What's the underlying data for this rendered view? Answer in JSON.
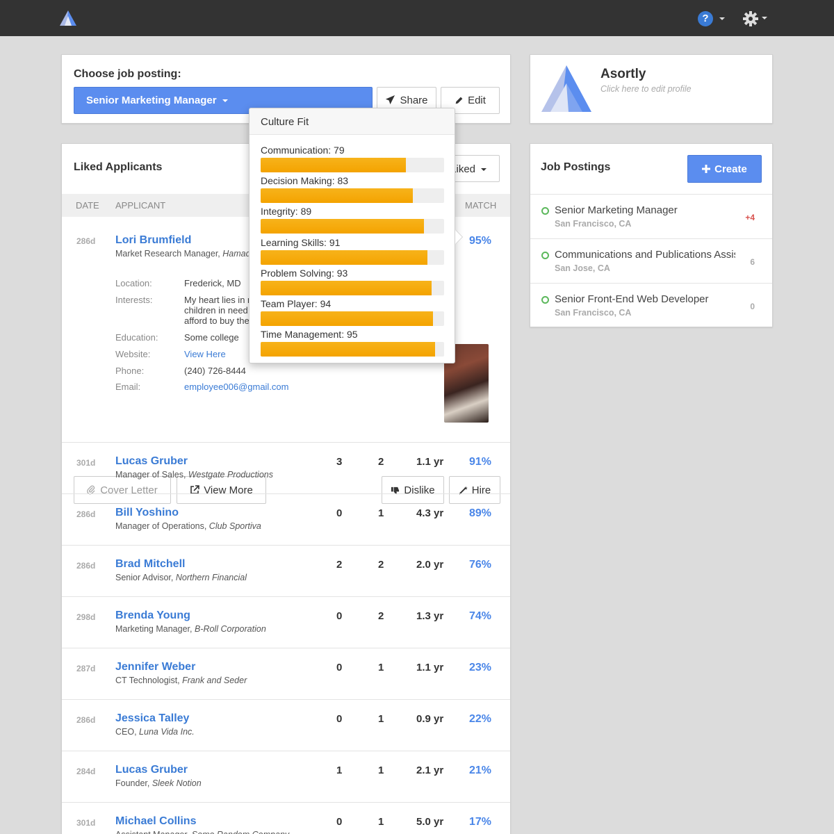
{
  "colors": {
    "accent": "#5b8def",
    "link": "#3a7bd5",
    "bar": "#f5a900",
    "online": "#5cb85c",
    "new": "#d9534f"
  },
  "nav": {
    "help_icon": "question-icon",
    "help_label": "?",
    "settings_icon": "gear-icon"
  },
  "choose": {
    "label": "Choose job posting:",
    "selected": "Senior Marketing Manager",
    "share_label": "Share",
    "edit_label": "Edit"
  },
  "profile": {
    "name": "Asortly",
    "hint": "Click here to edit profile"
  },
  "liked": {
    "title": "Liked Applicants",
    "filter_label": "Liked",
    "columns": {
      "date": "DATE",
      "applicant": "APPLICANT",
      "match": "MATCH"
    },
    "expanded": {
      "date": "286d",
      "name": "Lori Brumfield",
      "role": "Market Research Manager, ",
      "company": "Hamada",
      "match": "95%",
      "labels": {
        "location": "Location:",
        "interests": "Interests:",
        "education": "Education:",
        "website": "Website:",
        "phone": "Phone:",
        "email": "Email:"
      },
      "location": "Frederick, MD",
      "interests_1": "My heart lies in m",
      "interests_2": "children in need",
      "interests_3": "afford to buy the",
      "education": "Some college",
      "website": "View Here",
      "phone": "(240) 726-8444",
      "email": "employee006@gmail.com",
      "buttons": {
        "cover": "Cover Letter",
        "view_more": "View More",
        "dislike": "Dislike",
        "hire": "Hire"
      }
    },
    "rows": [
      {
        "date": "301d",
        "name": "Lucas Gruber",
        "role": "Manager of Sales, ",
        "company": "Westgate Productions",
        "c1": "3",
        "c2": "2",
        "exp": "1.1 yr",
        "match": "91%"
      },
      {
        "date": "286d",
        "name": "Bill Yoshino",
        "role": "Manager of Operations, ",
        "company": "Club Sportiva",
        "c1": "0",
        "c2": "1",
        "exp": "4.3 yr",
        "match": "89%"
      },
      {
        "date": "286d",
        "name": "Brad Mitchell",
        "role": "Senior Advisor, ",
        "company": "Northern Financial",
        "c1": "2",
        "c2": "2",
        "exp": "2.0 yr",
        "match": "76%"
      },
      {
        "date": "298d",
        "name": "Brenda Young",
        "role": "Marketing Manager, ",
        "company": "B-Roll Corporation",
        "c1": "0",
        "c2": "2",
        "exp": "1.3 yr",
        "match": "74%"
      },
      {
        "date": "287d",
        "name": "Jennifer Weber",
        "role": "CT Technologist, ",
        "company": "Frank and Seder",
        "c1": "0",
        "c2": "1",
        "exp": "1.1 yr",
        "match": "23%"
      },
      {
        "date": "286d",
        "name": "Jessica Talley",
        "role": "CEO, ",
        "company": "Luna Vida Inc.",
        "c1": "0",
        "c2": "1",
        "exp": "0.9 yr",
        "match": "22%"
      },
      {
        "date": "284d",
        "name": "Lucas Gruber",
        "role": "Founder, ",
        "company": "Sleek Notion",
        "c1": "1",
        "c2": "1",
        "exp": "2.1 yr",
        "match": "21%"
      },
      {
        "date": "301d",
        "name": "Michael Collins",
        "role": "Assistant Manager, ",
        "company": "Some Random Company",
        "c1": "0",
        "c2": "1",
        "exp": "5.0 yr",
        "match": "17%"
      }
    ]
  },
  "culture_fit": {
    "title": "Culture Fit",
    "skills": [
      {
        "label": "Communication: 79",
        "value": 79
      },
      {
        "label": "Decision Making: 83",
        "value": 83
      },
      {
        "label": "Integrity: 89",
        "value": 89
      },
      {
        "label": "Learning Skills: 91",
        "value": 91
      },
      {
        "label": "Problem Solving: 93",
        "value": 93
      },
      {
        "label": "Team Player: 94",
        "value": 94
      },
      {
        "label": "Time Management: 95",
        "value": 95
      }
    ]
  },
  "jobs": {
    "title": "Job Postings",
    "create_label": "Create",
    "items": [
      {
        "title": "Senior Marketing Manager",
        "location": "San Francisco, CA",
        "count": "+4"
      },
      {
        "title": "Communications and Publications Assistant",
        "location": "San Jose, CA",
        "count": "6"
      },
      {
        "title": "Senior Front-End Web Developer",
        "location": "San Francisco, CA",
        "count": "0"
      }
    ]
  }
}
